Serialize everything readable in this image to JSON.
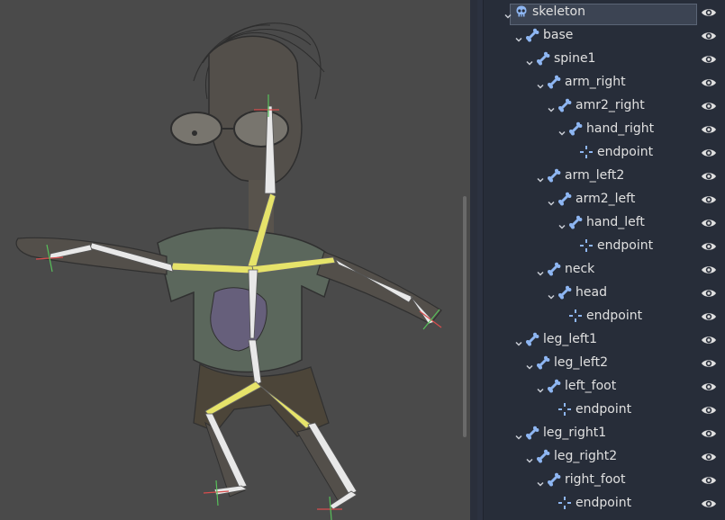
{
  "scene_tree": {
    "nodes": [
      {
        "label": "skeleton",
        "type": "skeleton",
        "depth": 0,
        "expanded": true,
        "selected": true,
        "icon": "skeleton-icon",
        "visible": true
      },
      {
        "label": "base",
        "type": "bone",
        "depth": 1,
        "expanded": true,
        "icon": "bone-icon",
        "visible": true
      },
      {
        "label": "spine1",
        "type": "bone",
        "depth": 2,
        "expanded": true,
        "icon": "bone-icon",
        "visible": true
      },
      {
        "label": "arm_right",
        "type": "bone",
        "depth": 3,
        "expanded": true,
        "icon": "bone-icon",
        "visible": true
      },
      {
        "label": "amr2_right",
        "type": "bone",
        "depth": 4,
        "expanded": true,
        "icon": "bone-icon",
        "visible": true
      },
      {
        "label": "hand_right",
        "type": "bone",
        "depth": 5,
        "expanded": true,
        "icon": "bone-icon",
        "visible": true
      },
      {
        "label": "endpoint",
        "type": "position",
        "depth": 6,
        "icon": "position-icon",
        "visible": true
      },
      {
        "label": "arm_left2",
        "type": "bone",
        "depth": 3,
        "expanded": true,
        "icon": "bone-icon",
        "visible": true
      },
      {
        "label": "arm2_left",
        "type": "bone",
        "depth": 4,
        "expanded": true,
        "icon": "bone-icon",
        "visible": true
      },
      {
        "label": "hand_left",
        "type": "bone",
        "depth": 5,
        "expanded": true,
        "icon": "bone-icon",
        "visible": true
      },
      {
        "label": "endpoint",
        "type": "position",
        "depth": 6,
        "icon": "position-icon",
        "visible": true
      },
      {
        "label": "neck",
        "type": "bone",
        "depth": 3,
        "expanded": true,
        "icon": "bone-icon",
        "visible": true
      },
      {
        "label": "head",
        "type": "bone",
        "depth": 4,
        "expanded": true,
        "icon": "bone-icon",
        "visible": true
      },
      {
        "label": "endpoint",
        "type": "position",
        "depth": 5,
        "icon": "position-icon",
        "visible": true
      },
      {
        "label": "leg_left1",
        "type": "bone",
        "depth": 1,
        "expanded": true,
        "icon": "bone-icon",
        "visible": true
      },
      {
        "label": "leg_left2",
        "type": "bone",
        "depth": 2,
        "expanded": true,
        "icon": "bone-icon",
        "visible": true
      },
      {
        "label": "left_foot",
        "type": "bone",
        "depth": 3,
        "expanded": true,
        "icon": "bone-icon",
        "visible": true
      },
      {
        "label": "endpoint",
        "type": "position",
        "depth": 4,
        "icon": "position-icon",
        "visible": true
      },
      {
        "label": "leg_right1",
        "type": "bone",
        "depth": 1,
        "expanded": true,
        "icon": "bone-icon",
        "visible": true
      },
      {
        "label": "leg_right2",
        "type": "bone",
        "depth": 2,
        "expanded": true,
        "icon": "bone-icon",
        "visible": true
      },
      {
        "label": "right_foot",
        "type": "bone",
        "depth": 3,
        "expanded": true,
        "icon": "bone-icon",
        "visible": true
      },
      {
        "label": "endpoint",
        "type": "position",
        "depth": 4,
        "icon": "position-icon",
        "visible": true
      }
    ]
  },
  "colors": {
    "viewport_bg": "#4a4a4a",
    "panel_bg": "#272d39",
    "icon_blue": "#8eb6f2",
    "bone_white": "#e8e8e8",
    "bone_selected": "#e6e36a",
    "text": "#e0e0e0"
  }
}
